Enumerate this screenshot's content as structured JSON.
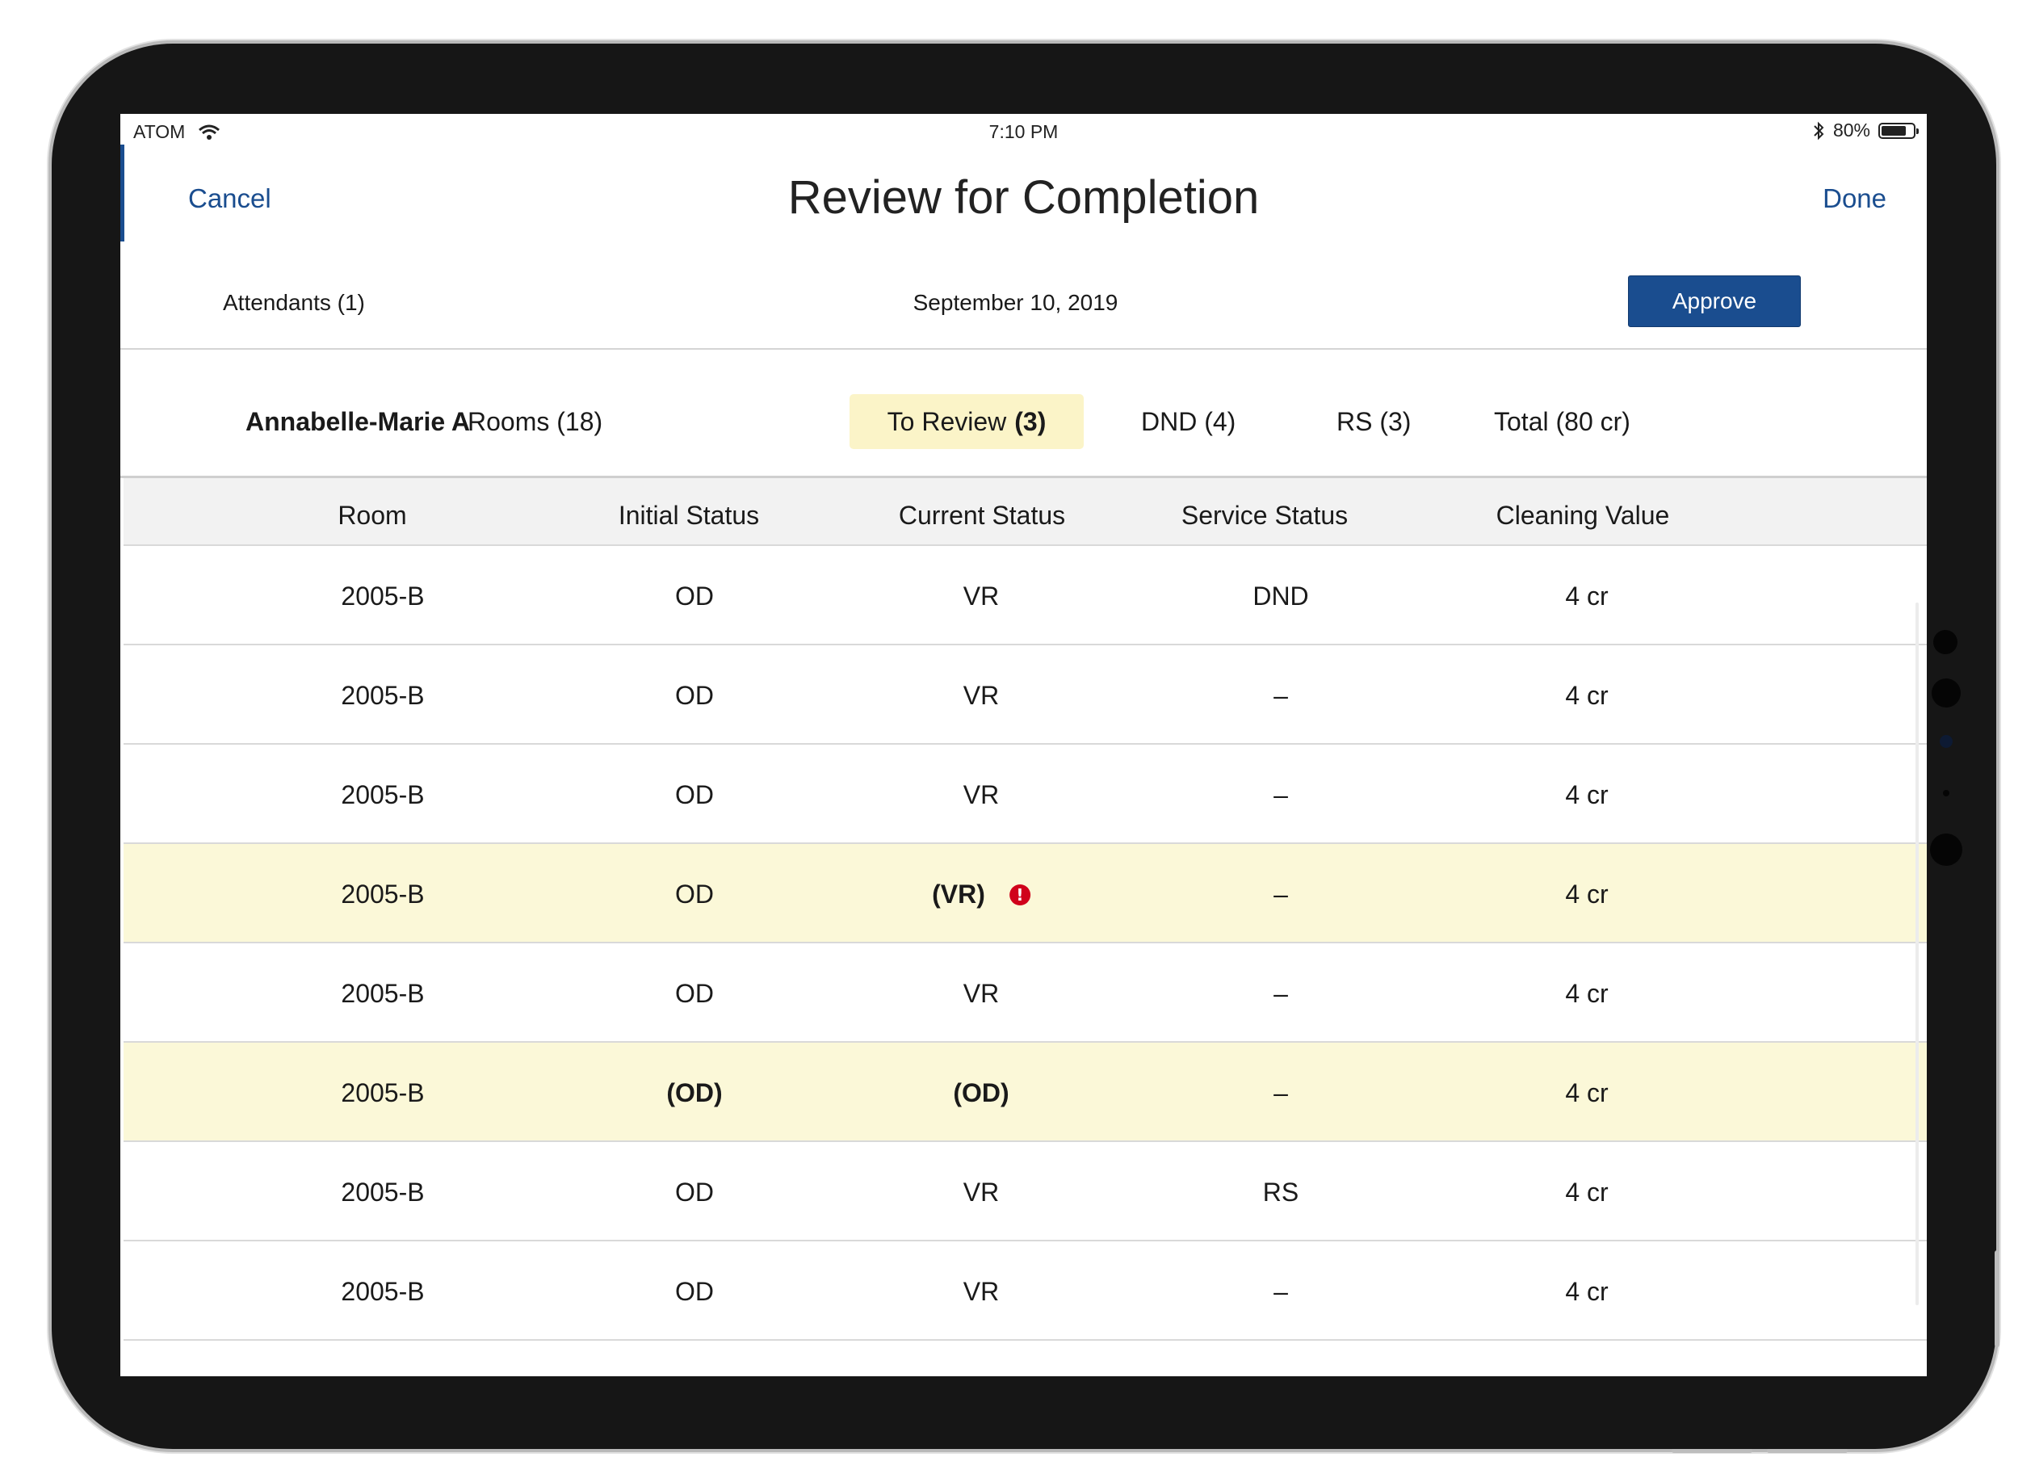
{
  "status_bar": {
    "carrier": "ATOM",
    "time": "7:10 PM",
    "battery": "80%",
    "battery_level": 0.8
  },
  "nav": {
    "cancel": "Cancel",
    "title": "Review for Completion",
    "done": "Done"
  },
  "subbar": {
    "attendants": "Attendants (1)",
    "date": "September 10, 2019",
    "approve": "Approve"
  },
  "tabs": {
    "name": "Annabelle-Marie A",
    "rooms": "Rooms (18)",
    "to_review": "To Review",
    "to_review_count": "(3)",
    "dnd": "DND (4)",
    "rs": "RS (3)",
    "total": "Total (80 cr)"
  },
  "table": {
    "headers": [
      "Room",
      "Initial Status",
      "Current Status",
      "Service Status",
      "Cleaning Value"
    ],
    "rows": [
      {
        "room": "2005-B",
        "initial": "OD",
        "current": "VR",
        "service": "DND",
        "value": "4 cr"
      },
      {
        "room": "2005-B",
        "initial": "OD",
        "current": "VR",
        "service": "–",
        "value": "4 cr"
      },
      {
        "room": "2005-B",
        "initial": "OD",
        "current": "VR",
        "service": "–",
        "value": "4 cr"
      },
      {
        "room": "2005-B",
        "initial": "OD",
        "current": "(VR)",
        "service": "–",
        "value": "4 cr",
        "alert": "!"
      },
      {
        "room": "2005-B",
        "initial": "OD",
        "current": "VR",
        "service": "–",
        "value": "4 cr"
      },
      {
        "room": "2005-B",
        "initial": "(OD)",
        "current": "(OD)",
        "service": "–",
        "value": "4 cr"
      },
      {
        "room": "2005-B",
        "initial": "OD",
        "current": "VR",
        "service": "RS",
        "value": "4 cr"
      },
      {
        "room": "2005-B",
        "initial": "OD",
        "current": "VR",
        "service": "–",
        "value": "4 cr"
      }
    ]
  },
  "colors": {
    "accent": "#1a4d8f",
    "highlight": "#fbf8d8",
    "active_tab": "#fbf4c8",
    "alert": "#d0021b"
  }
}
